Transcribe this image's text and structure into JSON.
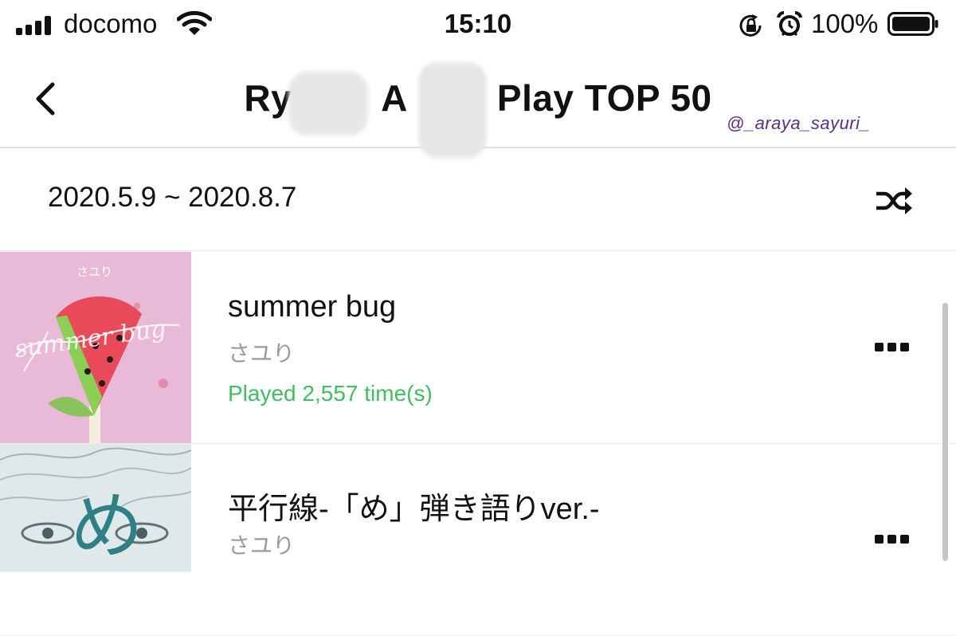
{
  "status_bar": {
    "carrier": "docomo",
    "time": "15:10",
    "battery_percent": "100%",
    "battery_level": 1.0,
    "icons": [
      "signal-bars-icon",
      "wifi-icon",
      "rotation-lock-icon",
      "alarm-icon",
      "battery-icon"
    ]
  },
  "header": {
    "title_part1": "Ry",
    "title_part2": "A",
    "title_part3": "Play TOP 50",
    "handle": "@_araya_sayuri_",
    "back_icon": "chevron-left-icon"
  },
  "period": {
    "range": "2020.5.9 ~ 2020.8.7",
    "shuffle_icon": "shuffle-icon"
  },
  "tracks": [
    {
      "title": "summer bug",
      "artist": "さユり",
      "plays": "Played 2,557 time(s)",
      "cover_artist": "さユり",
      "cover_text": "summer bug"
    },
    {
      "title": "平行線-「め」弾き語りver.-",
      "artist": "さユり",
      "cover_glyph": "め"
    }
  ],
  "colors": {
    "played_green": "#3fbf5f",
    "artist_gray": "#9a9a9a",
    "handle_purple": "#5a2d8a",
    "cover1_bg": "#e9b9d8",
    "cover2_bg": "#dfe9ea"
  }
}
